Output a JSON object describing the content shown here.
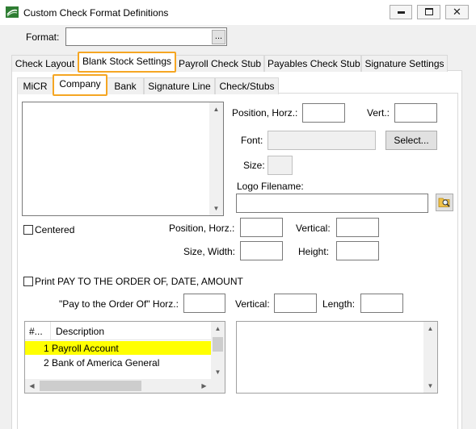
{
  "window": {
    "title": "Custom Check Format Definitions",
    "min_glyph": "▭",
    "max_glyph": "▢",
    "close_glyph": "✕"
  },
  "format": {
    "label": "Format:",
    "value": "",
    "browse_label": "..."
  },
  "tabs": [
    {
      "label": "Check Layout"
    },
    {
      "label": "Blank Stock Settings",
      "active": true,
      "highlighted": true
    },
    {
      "label": "Payroll Check Stub"
    },
    {
      "label": "Payables Check Stub"
    },
    {
      "label": "Signature Settings"
    }
  ],
  "subtabs": [
    {
      "label": "MiCR"
    },
    {
      "label": "Company",
      "active": true,
      "highlighted": true
    },
    {
      "label": "Bank"
    },
    {
      "label": "Signature Line"
    },
    {
      "label": "Check/Stubs"
    }
  ],
  "company": {
    "text_value": "",
    "position_horz_label": "Position, Horz.:",
    "position_horz_value": "",
    "vert_label": "Vert.:",
    "vert_value": "",
    "font_label": "Font:",
    "font_value": "",
    "select_button": "Select...",
    "size_label": "Size:",
    "size_value": "",
    "logo_label": "Logo Filename:",
    "logo_value": "",
    "centered_label": "Centered",
    "centered_checked": false,
    "logo_position_horz_label": "Position, Horz.:",
    "logo_position_horz_value": "",
    "vertical_label": "Vertical:",
    "vertical_value": "",
    "size_width_label": "Size, Width:",
    "size_width_value": "",
    "height_label": "Height:",
    "height_value": "",
    "print_pay_label": "Print PAY TO THE ORDER OF, DATE, AMOUNT",
    "print_pay_checked": false,
    "pay_horz_label": "\"Pay to the Order Of\" Horz.:",
    "pay_horz_value": "",
    "pay_vertical_label": "Vertical:",
    "pay_vertical_value": "",
    "length_label": "Length:",
    "length_value": ""
  },
  "accounts": {
    "columns": [
      "#...",
      "Description"
    ],
    "rows": [
      {
        "num": "1",
        "description": "Payroll Account",
        "selected": true
      },
      {
        "num": "2",
        "description": "Bank of America General",
        "selected": false
      }
    ]
  },
  "colors": {
    "highlight": "#f5a623",
    "selected_row": "#ffff00",
    "window_bg": "#f0f0f0"
  }
}
